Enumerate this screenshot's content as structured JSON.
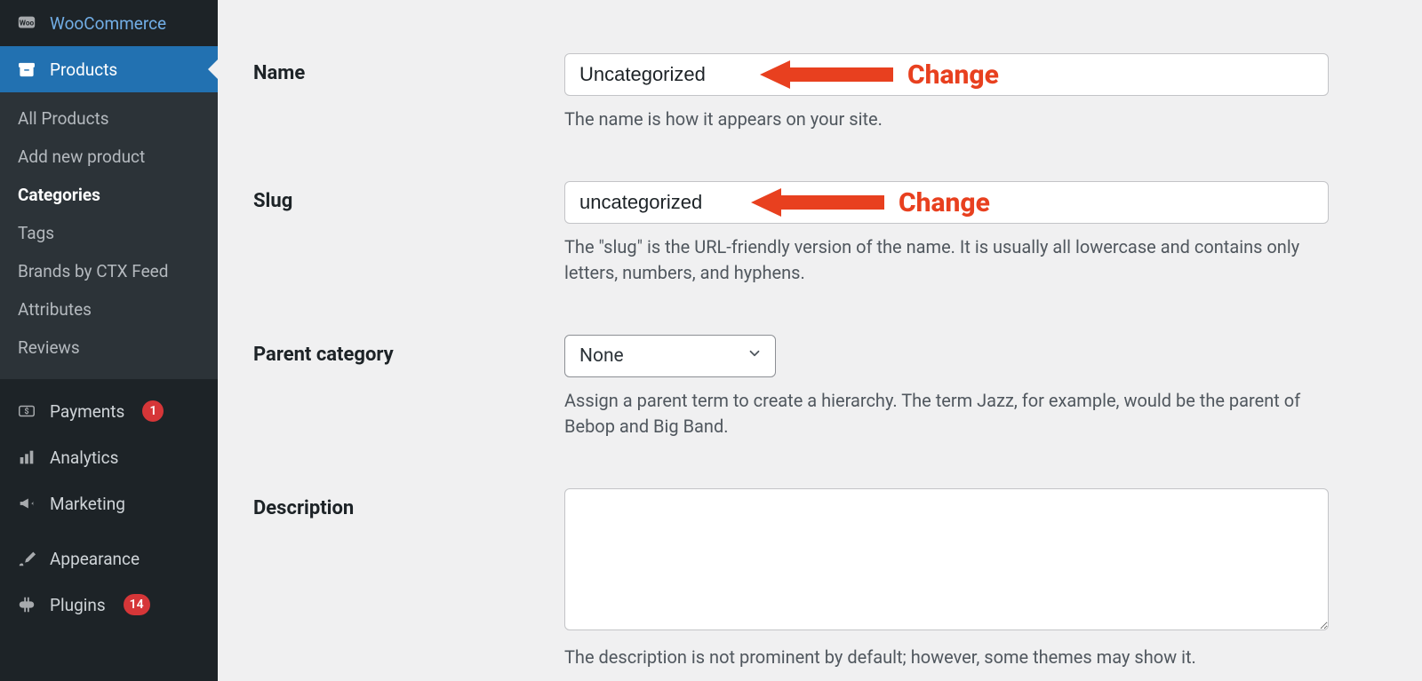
{
  "sidebar": {
    "items": [
      {
        "label": "WooCommerce",
        "icon": "woocommerce",
        "badge": null,
        "active": false
      },
      {
        "label": "Products",
        "icon": "archive",
        "badge": null,
        "active": true,
        "sub": [
          {
            "label": "All Products",
            "current": false
          },
          {
            "label": "Add new product",
            "current": false
          },
          {
            "label": "Categories",
            "current": true
          },
          {
            "label": "Tags",
            "current": false
          },
          {
            "label": "Brands by CTX Feed",
            "current": false
          },
          {
            "label": "Attributes",
            "current": false
          },
          {
            "label": "Reviews",
            "current": false
          }
        ]
      },
      {
        "label": "Payments",
        "icon": "payments",
        "badge": "1",
        "active": false
      },
      {
        "label": "Analytics",
        "icon": "analytics",
        "badge": null,
        "active": false
      },
      {
        "label": "Marketing",
        "icon": "marketing",
        "badge": null,
        "active": false
      },
      {
        "label": "Appearance",
        "icon": "appearance",
        "badge": null,
        "active": false
      },
      {
        "label": "Plugins",
        "icon": "plugins",
        "badge": "14",
        "active": false
      }
    ]
  },
  "form": {
    "name": {
      "label": "Name",
      "value": "Uncategorized",
      "help": "The name is how it appears on your site."
    },
    "slug": {
      "label": "Slug",
      "value": "uncategorized",
      "help": "The \"slug\" is the URL-friendly version of the name. It is usually all lowercase and contains only letters, numbers, and hyphens."
    },
    "parent": {
      "label": "Parent category",
      "value": "None",
      "help": "Assign a parent term to create a hierarchy. The term Jazz, for example, would be the parent of Bebop and Big Band."
    },
    "description": {
      "label": "Description",
      "value": "",
      "help": "The description is not prominent by default; however, some themes may show it."
    }
  },
  "annotations": {
    "change_label": "Change"
  },
  "colors": {
    "accent": "#2271b1",
    "danger": "#d63638",
    "arrow": "#e8401f"
  }
}
